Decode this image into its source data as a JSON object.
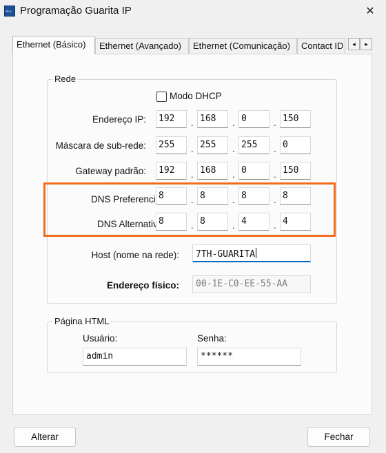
{
  "window": {
    "title": "Programação Guarita IP",
    "icon_text": "Nice",
    "close_symbol": "✕"
  },
  "tabs": [
    "Ethernet (Básico)",
    "Ethernet (Avançado)",
    "Ethernet (Comunicação)",
    "Contact ID"
  ],
  "tab_scroll": {
    "left": "◂",
    "right": "▸"
  },
  "rede": {
    "legend": "Rede",
    "dhcp_label": "Modo DHCP",
    "dhcp_checked": false,
    "separator": ".",
    "fields": [
      {
        "label": "Endereço IP:",
        "octets": [
          "192",
          "168",
          "0",
          "150"
        ]
      },
      {
        "label": "Máscara de sub-rede:",
        "octets": [
          "255",
          "255",
          "255",
          "0"
        ]
      },
      {
        "label": "Gateway padrão:",
        "octets": [
          "192",
          "168",
          "0",
          "150"
        ]
      },
      {
        "label": "DNS Preferencial:",
        "octets": [
          "8",
          "8",
          "8",
          "8"
        ]
      },
      {
        "label": "DNS Alternativo:",
        "octets": [
          "8",
          "8",
          "4",
          "4"
        ]
      }
    ],
    "host_label": "Host (nome na rede):",
    "host_value": "7TH-GUARITA",
    "mac_label": "Endereço físico:",
    "mac_value": "00-1E-C0-EE-55-AA"
  },
  "html_page": {
    "legend": "Página HTML",
    "user_label": "Usuário:",
    "user_value": "admin",
    "password_label": "Senha:",
    "password_value": "******"
  },
  "buttons": {
    "alter": "Alterar",
    "close": "Fechar"
  },
  "colors": {
    "highlight": "#f26a1b",
    "focus": "#0067c0"
  }
}
